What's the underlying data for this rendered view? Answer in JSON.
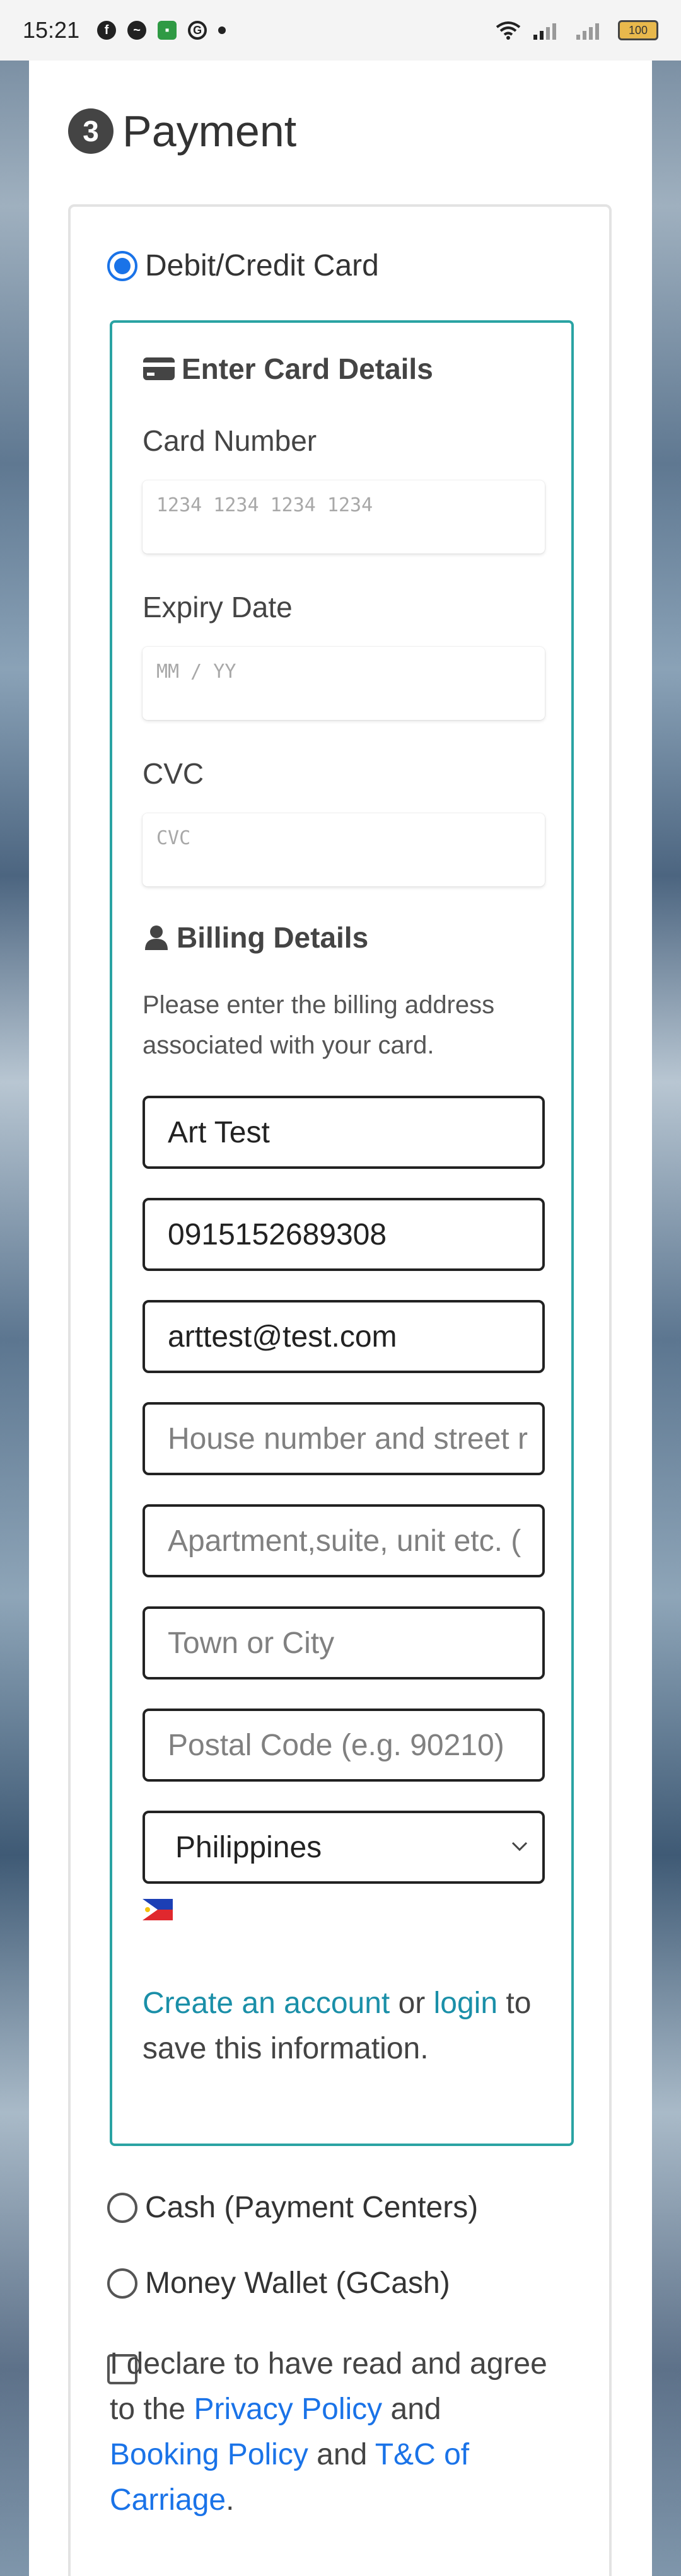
{
  "status_bar": {
    "time": "15:21",
    "battery": "100",
    "icons": [
      "facebook-icon",
      "messenger-icon",
      "chat-icon",
      "g-icon",
      "dot"
    ]
  },
  "section": {
    "step": "3",
    "title": "Payment"
  },
  "payment_options": {
    "card_label": "Debit/Credit Card",
    "cash_label": "Cash (Payment Centers)",
    "wallet_label": "Money Wallet (GCash)"
  },
  "card_details": {
    "title": "Enter Card Details",
    "card_number_label": "Card Number",
    "card_number_placeholder": "1234 1234 1234 1234",
    "expiry_label": "Expiry Date",
    "expiry_placeholder": "MM / YY",
    "cvc_label": "CVC",
    "cvc_placeholder": "CVC"
  },
  "billing": {
    "title": "Billing Details",
    "description": "Please enter the billing address associated with your card.",
    "name_value": "Art Test",
    "phone_value": "0915152689308",
    "email_value": "arttest@test.com",
    "street_placeholder": "House number and street r",
    "apartment_placeholder": "Apartment,suite, unit etc. (",
    "city_placeholder": "Town or City",
    "postal_placeholder": "Postal Code (e.g. 90210)",
    "country_value": "Philippines"
  },
  "account": {
    "create_link": "Create an account",
    "or_text": " or ",
    "login_link": "login",
    "suffix": " to save this information."
  },
  "declaration": {
    "prefix": "I declare to have read and agree to the ",
    "privacy_link": "Privacy Policy",
    "and1": " and ",
    "booking_link": "Booking Policy",
    "and2": " and ",
    "tc_link": "T&C of Carriage",
    "end": "."
  },
  "colors": {
    "accent_teal": "#2aa3a3",
    "link_teal": "#1a8fa8",
    "link_blue": "#1a73e8"
  }
}
